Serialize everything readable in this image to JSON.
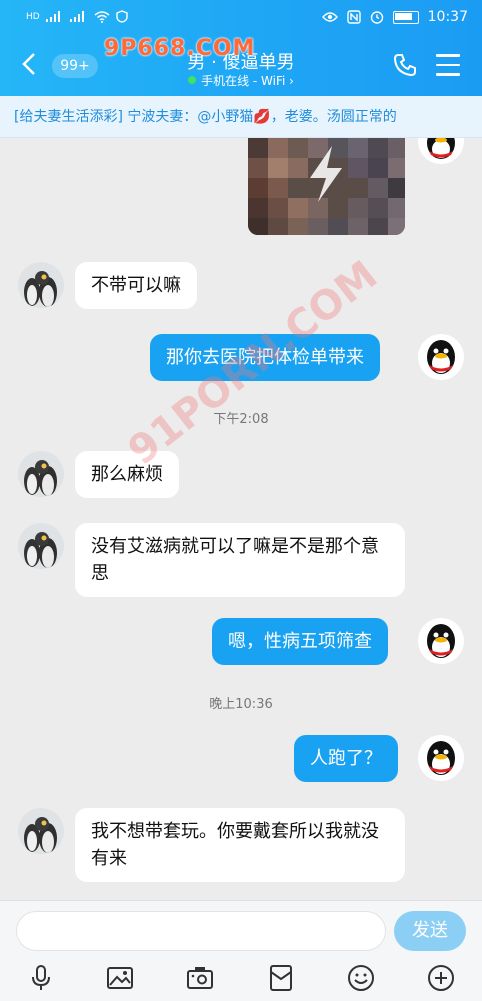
{
  "status": {
    "time": "10:37",
    "left_icons": [
      "HD-signal-icon",
      "wifi-icon",
      "shield-icon"
    ],
    "right_icons": [
      "eye-icon",
      "nfc-icon",
      "alarm-icon",
      "battery-icon"
    ]
  },
  "header": {
    "unread_count": "99+",
    "title": "男 · 傻逼单男",
    "subtitle": "手机在线 - WiFi ›",
    "watermark": "9P668.COM"
  },
  "banner": {
    "text": "[给夫妻生活添彩] 宁波夫妻：@小野猫💋，老婆。汤圆正常的"
  },
  "messages": [
    {
      "side": "in",
      "text": "不带可以嘛"
    },
    {
      "side": "out",
      "text": "那你去医院把体检单带来"
    },
    {
      "type": "time",
      "text": "下午2:08"
    },
    {
      "side": "in",
      "text": "那么麻烦"
    },
    {
      "side": "in",
      "text": "没有艾滋病就可以了嘛是不是那个意思"
    },
    {
      "side": "out",
      "text": "嗯，性病五项筛查"
    },
    {
      "type": "time",
      "text": "晚上10:36"
    },
    {
      "side": "out",
      "text": "人跑了？"
    },
    {
      "side": "in",
      "text": "我不想带套玩。你要戴套所以我就没有来"
    }
  ],
  "watermark2": "91PORN.COM",
  "input": {
    "placeholder": "",
    "send_label": "发送",
    "tools": [
      "microphone-icon",
      "image-icon",
      "camera-icon",
      "red-packet-icon",
      "emoji-icon",
      "plus-icon"
    ]
  }
}
